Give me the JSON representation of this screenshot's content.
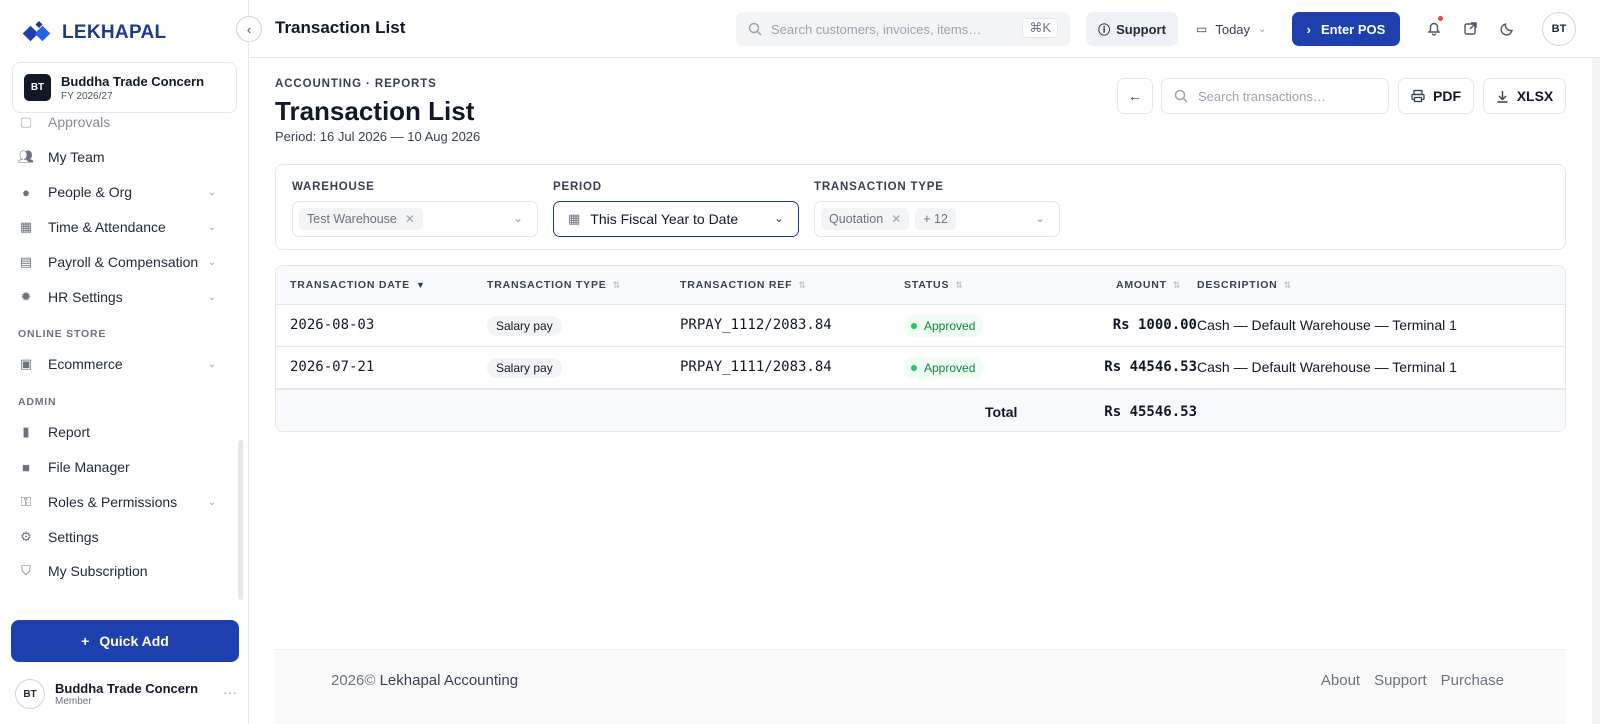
{
  "brand": {
    "name": "LEKHAPAL",
    "color": "#1e3a8a"
  },
  "org": {
    "initials": "BT",
    "name": "Buddha Trade Concern",
    "fy": "FY 2026/27"
  },
  "sidebar": {
    "items": [
      {
        "label": "Approvals",
        "icon": "approvals-icon"
      },
      {
        "label": "My Team",
        "icon": "team-icon"
      },
      {
        "label": "People & Org",
        "icon": "people-icon",
        "expandable": true
      },
      {
        "label": "Time & Attendance",
        "icon": "calendar-icon",
        "expandable": true
      },
      {
        "label": "Payroll & Compensation",
        "icon": "payroll-icon",
        "expandable": true
      },
      {
        "label": "HR Settings",
        "icon": "gear-icon",
        "expandable": true
      },
      {
        "label": "Ecommerce",
        "icon": "store-icon",
        "expandable": true
      },
      {
        "label": "Report",
        "icon": "chart-icon"
      },
      {
        "label": "File Manager",
        "icon": "folder-icon"
      },
      {
        "label": "Roles & Permissions",
        "icon": "key-icon",
        "expandable": true
      },
      {
        "label": "Settings",
        "icon": "settings-icon"
      },
      {
        "label": "My Subscription",
        "icon": "shield-icon"
      }
    ],
    "sections": {
      "online_store": "ONLINE STORE",
      "admin": "ADMIN"
    },
    "quick_add": "Quick Add"
  },
  "user": {
    "initials": "BT",
    "name": "Buddha Trade Concern",
    "role": "Member"
  },
  "topbar": {
    "title": "Transaction List",
    "search_placeholder": "Search customers, invoices, items…",
    "search_shortcut": "⌘K",
    "support": "Support",
    "date_range": "Today",
    "enter_pos": "Enter POS",
    "avatar": "BT"
  },
  "page": {
    "breadcrumb": "ACCOUNTING · REPORTS",
    "title": "Transaction List",
    "period": "Period: 16 Jul 2026 — 10 Aug 2026",
    "search_placeholder": "Search transactions…",
    "pdf": "PDF",
    "xlsx": "XLSX"
  },
  "filters": {
    "warehouse": {
      "label": "WAREHOUSE",
      "chip": "Test Warehouse"
    },
    "period": {
      "label": "PERIOD",
      "value": "This Fiscal Year to Date"
    },
    "transaction_type": {
      "label": "TRANSACTION TYPE",
      "chip": "Quotation",
      "more": "+ 12"
    }
  },
  "table": {
    "headers": {
      "date": "TRANSACTION DATE",
      "type": "TRANSACTION TYPE",
      "ref": "TRANSACTION REF",
      "status": "STATUS",
      "amount": "AMOUNT",
      "description": "DESCRIPTION"
    },
    "rows": [
      {
        "date": "2026-08-03",
        "type": "Salary pay",
        "ref": "PRPAY_1112/2083.84",
        "status": "Approved",
        "amount": "Rs 1000.00",
        "description": "Cash — Default Warehouse — Terminal 1"
      },
      {
        "date": "2026-07-21",
        "type": "Salary pay",
        "ref": "PRPAY_1111/2083.84",
        "status": "Approved",
        "amount": "Rs 44546.53",
        "description": "Cash — Default Warehouse — Terminal 1"
      }
    ],
    "total_label": "Total",
    "total_amount": "Rs 45546.53"
  },
  "footer": {
    "year": "2026©",
    "company": "Lekhapal Accounting",
    "links": [
      "About",
      "Support",
      "Purchase"
    ]
  },
  "colors": {
    "primary": "#1e40af",
    "approved": "#15803d"
  }
}
